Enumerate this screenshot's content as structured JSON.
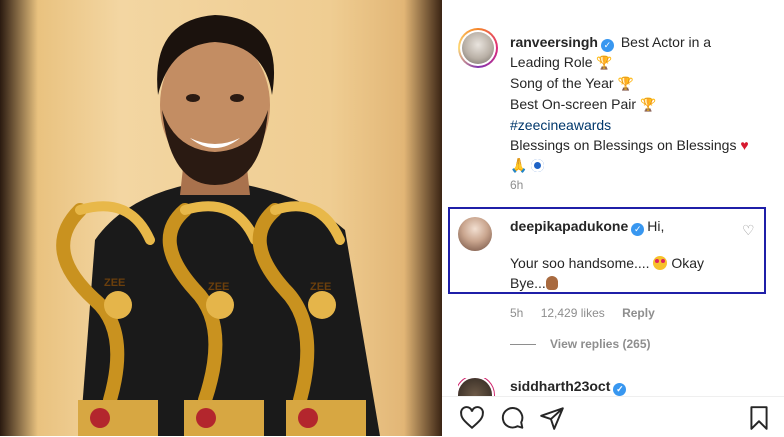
{
  "post": {
    "username": "ranveersingh",
    "caption_lines": [
      "Best Actor in a",
      "Leading Role",
      "Song of the Year",
      "Best On-screen Pair",
      "#zeecineawards",
      "Blessings on Blessings on Blessings"
    ],
    "time": "6h"
  },
  "comment": {
    "username": "deepikapadukone",
    "text_start": "Hi,",
    "text_line2": "Your soo handsome....",
    "text_end": "Okay",
    "text_line3": "Bye...",
    "time": "5h",
    "likes": "12,429 likes",
    "reply": "Reply",
    "view_replies": "View replies (265)"
  },
  "next_comment": {
    "username": "siddharth23oct"
  },
  "photo": {
    "trophy_brand": "ZEE"
  },
  "colors": {
    "verified": "#3897f0",
    "highlight_border": "#1f1fa8",
    "hashtag": "#00376b",
    "secondary_text": "#8e8e8e"
  },
  "icons": [
    "verified-badge-icon",
    "trophy-icon",
    "red-heart-icon",
    "folded-hands-icon",
    "nazar-icon",
    "heart-outline-icon",
    "star-struck-emoji-icon",
    "waving-hand-icon",
    "like-icon",
    "comment-icon",
    "share-icon",
    "bookmark-icon"
  ]
}
